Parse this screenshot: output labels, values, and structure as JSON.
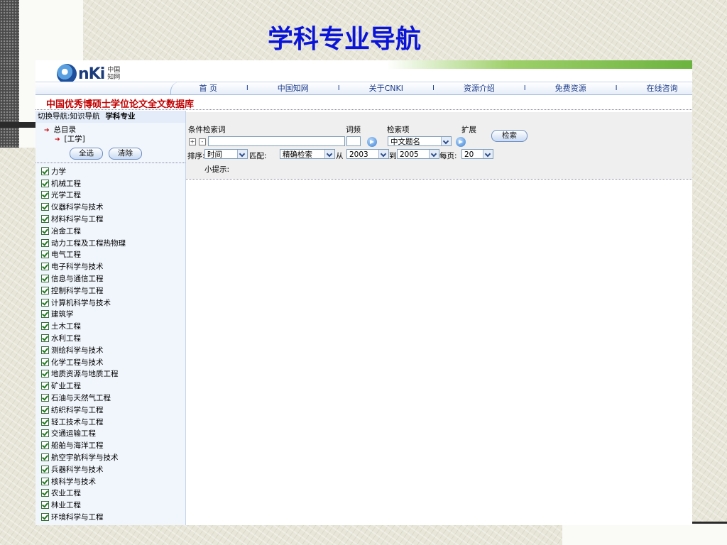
{
  "slide": {
    "title": "学科专业导航"
  },
  "portal": {
    "logo_text": "nKi",
    "logo_sub": "中国知网",
    "nav": [
      "首 页",
      "中国知网",
      "关于CNKI",
      "资源介绍",
      "免费资源",
      "在线咨询"
    ],
    "nav_separator": "I",
    "db_title": "中国优秀博硕士学位论文全文数据库"
  },
  "sidebar": {
    "switch_label": "切换导航:知识导航",
    "active_nav": "学科专业",
    "tree": {
      "root": "总目录",
      "child": "[工学]"
    },
    "select_all": "全选",
    "clear": "清除",
    "subjects": [
      "力学",
      "机械工程",
      "光学工程",
      "仪器科学与技术",
      "材料科学与工程",
      "冶金工程",
      "动力工程及工程热物理",
      "电气工程",
      "电子科学与技术",
      "信息与通信工程",
      "控制科学与工程",
      "计算机科学与技术",
      "建筑学",
      "土木工程",
      "水利工程",
      "测绘科学与技术",
      "化学工程与技术",
      "地质资源与地质工程",
      "矿业工程",
      "石油与天然气工程",
      "纺织科学与工程",
      "轻工技术与工程",
      "交通运输工程",
      "船舶与海洋工程",
      "航空宇航科学与技术",
      "兵器科学与技术",
      "核科学与技术",
      "农业工程",
      "林业工程",
      "环境科学与工程"
    ]
  },
  "search": {
    "condition_label": "条件检索词",
    "freq_label": "词频",
    "field_label": "检索项",
    "expand_label": "扩展",
    "search_button": "检索",
    "plus": "+",
    "minus": "-",
    "keyword_value": "",
    "field_value": "中文题名",
    "sort_label": "排序:",
    "sort_value": "时间",
    "match_label": "匹配:",
    "match_value": "精确检索",
    "from_label": "从",
    "from_value": "2003",
    "to_label": "到",
    "to_value": "2005",
    "per_page_label": "每页:",
    "per_page_value": "20",
    "tip_label": "小提示:"
  }
}
